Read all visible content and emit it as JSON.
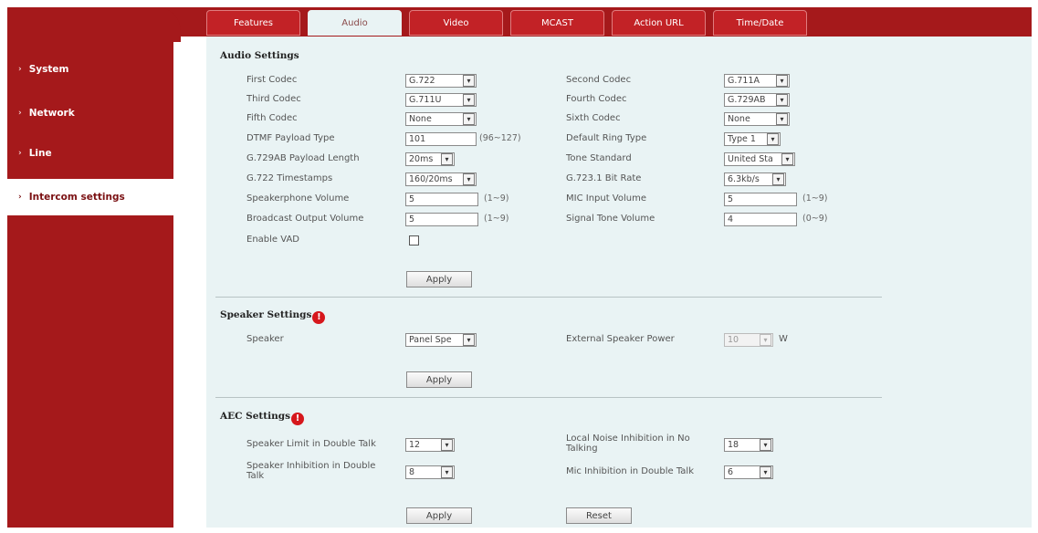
{
  "sidebar": {
    "items": [
      {
        "label": "System"
      },
      {
        "label": "Network"
      },
      {
        "label": "Line"
      },
      {
        "label": "Intercom settings"
      }
    ]
  },
  "tabs": [
    {
      "label": "Features"
    },
    {
      "label": "Audio"
    },
    {
      "label": "Video"
    },
    {
      "label": "MCAST"
    },
    {
      "label": "Action URL"
    },
    {
      "label": "Time/Date"
    }
  ],
  "audio": {
    "title": "Audio Settings",
    "first_codec": {
      "label": "First Codec",
      "value": "G.722"
    },
    "second_codec": {
      "label": "Second Codec",
      "value": "G.711A"
    },
    "third_codec": {
      "label": "Third Codec",
      "value": "G.711U"
    },
    "fourth_codec": {
      "label": "Fourth Codec",
      "value": "G.729AB"
    },
    "fifth_codec": {
      "label": "Fifth Codec",
      "value": "None"
    },
    "sixth_codec": {
      "label": "Sixth Codec",
      "value": "None"
    },
    "dtmf_payload": {
      "label": "DTMF Payload Type",
      "value": "101",
      "hint": "(96~127)"
    },
    "default_ring": {
      "label": "Default Ring Type",
      "value": "Type 1"
    },
    "g729_length": {
      "label": "G.729AB Payload Length",
      "value": "20ms"
    },
    "tone_standard": {
      "label": "Tone Standard",
      "value": "United Sta"
    },
    "g722_timestamps": {
      "label": "G.722 Timestamps",
      "value": "160/20ms"
    },
    "g7231_bitrate": {
      "label": "G.723.1 Bit Rate",
      "value": "6.3kb/s"
    },
    "speakerphone_volume": {
      "label": "Speakerphone Volume",
      "value": "5",
      "hint": "(1~9)"
    },
    "mic_input_volume": {
      "label": "MIC Input Volume",
      "value": "5",
      "hint": "(1~9)"
    },
    "broadcast_volume": {
      "label": "Broadcast Output Volume",
      "value": "5",
      "hint": "(1~9)"
    },
    "signal_tone_volume": {
      "label": "Signal Tone Volume",
      "value": "4",
      "hint": "(0~9)"
    },
    "enable_vad": {
      "label": "Enable VAD",
      "checked": false
    },
    "apply_label": "Apply"
  },
  "speaker": {
    "title": "Speaker Settings",
    "speaker": {
      "label": "Speaker",
      "value": "Panel Spe"
    },
    "ext_power": {
      "label": "External Speaker Power",
      "value": "10",
      "unit": "W"
    },
    "apply_label": "Apply"
  },
  "aec": {
    "title": "AEC Settings",
    "speaker_limit": {
      "label": "Speaker Limit in Double Talk",
      "value": "12"
    },
    "local_noise": {
      "label_line1": "Local Noise Inhibition in No",
      "label_line2": "Talking",
      "value": "18"
    },
    "speaker_inhibition": {
      "label_line1": "Speaker Inhibition in Double",
      "label_line2": "Talk",
      "value": "8"
    },
    "mic_inhibition": {
      "label": "Mic Inhibition in Double Talk",
      "value": "6"
    },
    "apply_label": "Apply",
    "reset_label": "Reset"
  },
  "icons": {
    "dropdown": "▾",
    "info": "!",
    "arrow": "›"
  },
  "colors": {
    "brand_red": "#a5191b",
    "tab_red": "#c22226",
    "panel_bg": "#e9f3f4",
    "info_red": "#d6171c"
  }
}
